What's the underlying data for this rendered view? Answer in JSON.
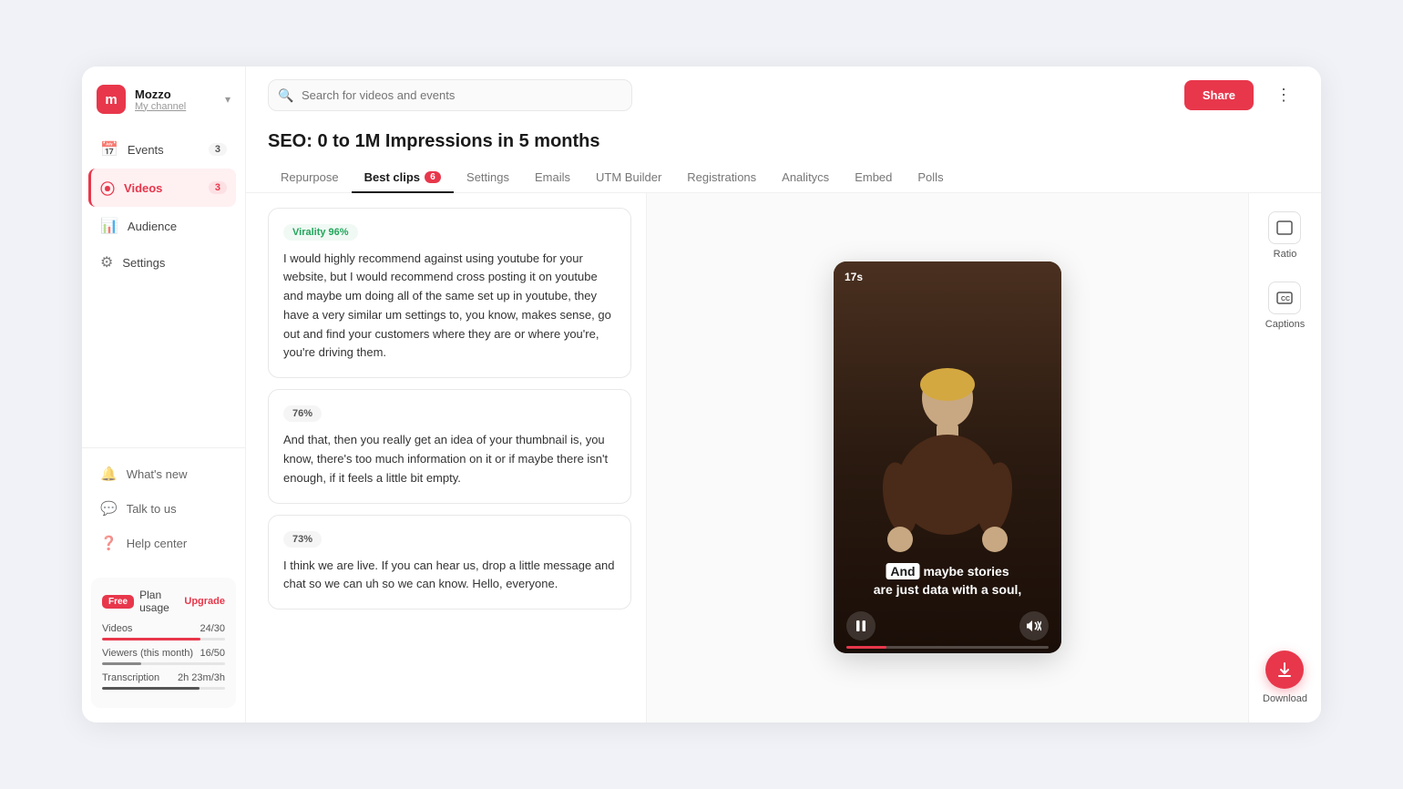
{
  "app": {
    "brand": {
      "initial": "m",
      "name": "Mozzo",
      "sub": "My channel"
    }
  },
  "sidebar": {
    "nav_items": [
      {
        "id": "events",
        "label": "Events",
        "badge": "3",
        "icon": "📅",
        "active": false
      },
      {
        "id": "videos",
        "label": "Videos",
        "badge": "3",
        "icon": "▶",
        "active": true
      },
      {
        "id": "audience",
        "label": "Audience",
        "badge": "",
        "icon": "📊",
        "active": false
      },
      {
        "id": "settings",
        "label": "Settings",
        "badge": "",
        "icon": "⚙",
        "active": false
      }
    ],
    "bottom_items": [
      {
        "id": "whats-new",
        "label": "What's new",
        "icon": "🔔"
      },
      {
        "id": "talk-to-us",
        "label": "Talk to us",
        "icon": "💬"
      },
      {
        "id": "help-center",
        "label": "Help center",
        "icon": "❓"
      }
    ],
    "plan": {
      "badge": "Free",
      "label": "Plan usage",
      "upgrade": "Upgrade",
      "rows": [
        {
          "label": "Videos",
          "value": "24/30",
          "fill_pct": 80,
          "color": "#e8374b"
        },
        {
          "label": "Viewers (this month)",
          "value": "16/50",
          "fill_pct": 32,
          "color": "#555"
        },
        {
          "label": "Transcription",
          "value": "2h 23m/3h",
          "fill_pct": 79,
          "color": "#555"
        }
      ]
    }
  },
  "header": {
    "search_placeholder": "Search for videos and events",
    "share_label": "Share",
    "more_icon": "⋮"
  },
  "event": {
    "title": "SEO: 0 to 1M Impressions in 5 months",
    "tabs": [
      {
        "id": "repurpose",
        "label": "Repurpose",
        "active": false,
        "badge": null
      },
      {
        "id": "best-clips",
        "label": "Best clips",
        "active": true,
        "badge": "6"
      },
      {
        "id": "settings",
        "label": "Settings",
        "active": false,
        "badge": null
      },
      {
        "id": "emails",
        "label": "Emails",
        "active": false,
        "badge": null
      },
      {
        "id": "utm-builder",
        "label": "UTM Builder",
        "active": false,
        "badge": null
      },
      {
        "id": "registrations",
        "label": "Registrations",
        "active": false,
        "badge": null
      },
      {
        "id": "analitycs",
        "label": "Analitycs",
        "active": false,
        "badge": null
      },
      {
        "id": "embed",
        "label": "Embed",
        "active": false,
        "badge": null
      },
      {
        "id": "polls",
        "label": "Polls",
        "active": false,
        "badge": null
      }
    ]
  },
  "clips": [
    {
      "id": 1,
      "badge": "Virality 96%",
      "badge_type": "virality",
      "text": "I would highly recommend against using youtube for your website, but I would recommend cross posting it on youtube and maybe um doing all of the same set up in youtube, they have a very similar um settings to, you know, makes sense, go out and find your customers where they are or where you're, you're driving them."
    },
    {
      "id": 2,
      "badge": "76%",
      "badge_type": "normal",
      "text": "And that, then you really get an idea of your thumbnail is, you know, there's too much information on it or if maybe there isn't enough, if it feels a little bit empty."
    },
    {
      "id": 3,
      "badge": "73%",
      "badge_type": "normal",
      "text": "I think we are live. If you can hear us, drop a little message and chat so we can uh so we can know. Hello, everyone."
    }
  ],
  "video": {
    "timer": "17s",
    "caption_highlight": "And",
    "caption_rest": " maybe stories\nare just data with a soul,",
    "progress_pct": 20
  },
  "tools": [
    {
      "id": "ratio",
      "label": "Ratio",
      "icon": "▭"
    },
    {
      "id": "captions",
      "label": "Captions",
      "icon": "CC"
    }
  ],
  "download_label": "Download"
}
